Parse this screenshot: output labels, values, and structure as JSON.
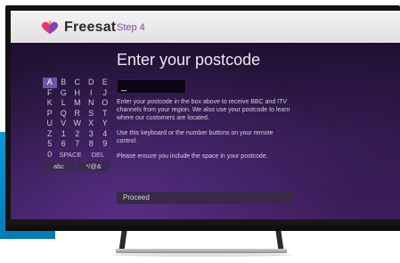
{
  "brand": {
    "name": "Freesat"
  },
  "header": {
    "step": "Step 4"
  },
  "page": {
    "title": "Enter your postcode"
  },
  "postcode_input": {
    "value": "_"
  },
  "keyboard": {
    "rows": [
      [
        "A",
        "B",
        "C",
        "D",
        "E"
      ],
      [
        "F",
        "G",
        "H",
        "I",
        "J"
      ],
      [
        "K",
        "L",
        "M",
        "N",
        "O"
      ],
      [
        "P",
        "Q",
        "R",
        "S",
        "T"
      ],
      [
        "U",
        "V",
        "W",
        "X",
        "Y"
      ],
      [
        "Z",
        "1",
        "2",
        "3",
        "4"
      ],
      [
        "5",
        "6",
        "7",
        "8",
        "9"
      ]
    ],
    "bottom": {
      "zero": "0",
      "space": "SPACE",
      "del": "DEL"
    },
    "modes": {
      "lower": "abc",
      "symbols": "*/@&"
    },
    "selected": "A"
  },
  "instructions": [
    "Enter your postcode in the box above to receive BBC and ITV channels from your region. We also use your postcode to learn where our customers are located.",
    "Use this keyboard or the number buttons on your remote control.",
    "Please ensure you include the space in your postcode."
  ],
  "proceed": {
    "label": "Proceed"
  },
  "colors": {
    "accent": "#7a4ca0",
    "selected_key": "#6a57a8",
    "background": "#251437"
  }
}
